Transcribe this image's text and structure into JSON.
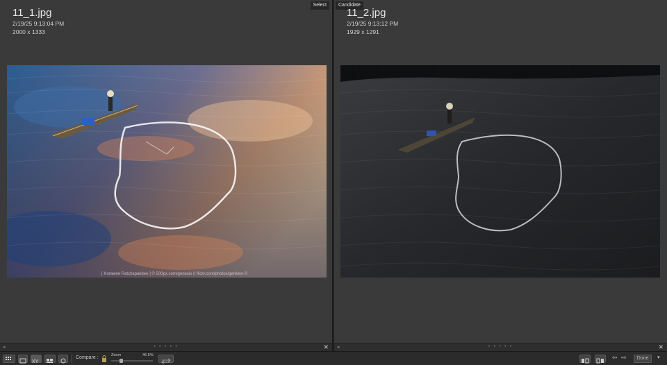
{
  "left_pane": {
    "tag": "Select",
    "filename": "11_1.jpg",
    "date": "2/19/25 9:13:04 PM",
    "dimensions": "2000 x 1333",
    "watermark": "[ Korawee Ratchapakdee ] © 500px.com/genesis // flickr.com/photos/genkew ©"
  },
  "right_pane": {
    "tag": "Candidate",
    "filename": "11_2.jpg",
    "date": "2/19/25 9:13:12 PM",
    "dimensions": "1929 x 1291"
  },
  "pane_strip": {
    "dots": "• • • • •",
    "close": "✕"
  },
  "toolbar": {
    "compare_label": "Compare :",
    "zoom_label": "Zoom",
    "zoom_value": "46.5%",
    "done_label": "Done"
  },
  "icons": {
    "grid_view": "grid-icon",
    "loupe_view": "loupe-icon",
    "compare_view": "compare-icon",
    "survey_view": "survey-icon",
    "people_view": "people-icon",
    "lock": "lock-icon",
    "swap": "swap-icon",
    "make_select": "make-select-icon",
    "prev": "arrow-left-icon",
    "next": "arrow-right-icon",
    "menu": "chevron-down-icon"
  }
}
